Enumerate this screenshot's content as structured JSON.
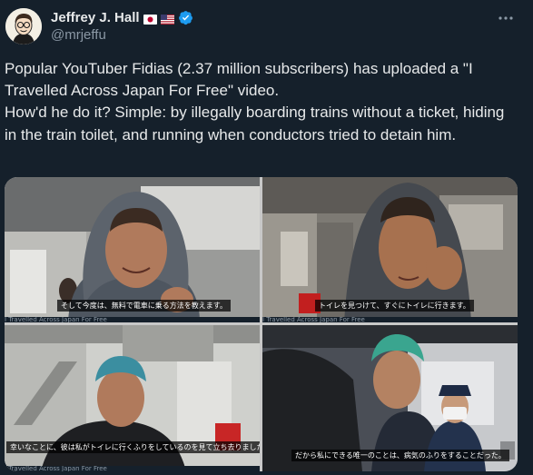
{
  "author": {
    "display_name": "Jeffrey J. Hall",
    "handle": "@mrjeffu",
    "badges": [
      "flag-japan-icon",
      "flag-usa-icon",
      "verified-badge-icon"
    ]
  },
  "tweet": {
    "paragraph_1": "Popular YouTuber Fidias (2.37 million subscribers) has uploaded a \"I Travelled Across Japan For Free\" video.",
    "paragraph_2": "How'd he do it?  Simple: by illegally boarding trains without a ticket, hiding in the train toilet, and running when conductors tried to detain him."
  },
  "media": [
    {
      "subtitle": "そして今度は、無料で電車に乗る方法を教えます。",
      "caption": "I Travelled Across Japan For Free"
    },
    {
      "subtitle": "トイレを見つけて、すぐにトイレに行きます。",
      "caption": "I Travelled Across Japan For Free"
    },
    {
      "subtitle": "幸いなことに、彼は私がトイレに行くふりをしているのを見て立ち去りました。",
      "caption": "I Travelled Across Japan For Free"
    },
    {
      "subtitle": "だから私にできる唯一のことは、病気のふりをすることだった。"
    }
  ],
  "colors": {
    "background": "#15202b",
    "text": "#e7e9ea",
    "secondary_text": "#8b98a5",
    "verified": "#1d9bf0"
  }
}
